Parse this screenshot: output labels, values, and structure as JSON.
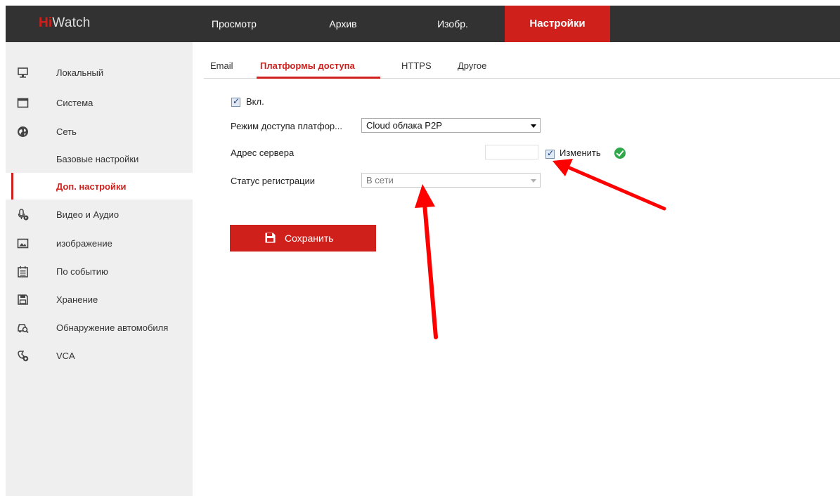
{
  "header": {
    "logo_hi": "Hi",
    "logo_rest": "Watch",
    "nav": [
      {
        "label": "Просмотр"
      },
      {
        "label": "Архив"
      },
      {
        "label": "Изобр."
      },
      {
        "label": "Настройки",
        "active": true
      }
    ]
  },
  "sidebar": {
    "items": [
      {
        "label": "Локальный",
        "icon": "monitor-icon"
      },
      {
        "label": "Система",
        "icon": "window-icon"
      },
      {
        "label": "Сеть",
        "icon": "globe-icon"
      },
      {
        "label": "Базовые настройки"
      },
      {
        "label": "Доп. настройки",
        "active": true
      },
      {
        "label": "Видео и Аудио",
        "icon": "microphone-icon"
      },
      {
        "label": "изображение",
        "icon": "image-icon"
      },
      {
        "label": "По событию",
        "icon": "calendar-icon"
      },
      {
        "label": "Хранение",
        "icon": "floppy-disk-icon"
      },
      {
        "label": "Обнаружение автомобиля",
        "icon": "car-search-icon"
      },
      {
        "label": "VCA",
        "icon": "vca-icon"
      }
    ]
  },
  "tabs": [
    {
      "label": "Email"
    },
    {
      "label": "Платформы доступа",
      "active": true
    },
    {
      "label": "HTTPS"
    },
    {
      "label": "Другое"
    }
  ],
  "form": {
    "enable_label": "Вкл.",
    "enable_checked": true,
    "mode_label": "Режим доступа платфор...",
    "mode_value": "Cloud облака P2P",
    "server_label": "Адрес сервера",
    "server_value": "",
    "change_label": "Изменить",
    "change_checked": true,
    "status_label": "Статус регистрации",
    "status_value": "В сети"
  },
  "save_button": {
    "label": "Сохранить"
  },
  "colors": {
    "accent": "#d0201b",
    "topbar": "#323232",
    "sidebar": "#efefef",
    "ok": "#2fa84a",
    "annotation": "#ff0000"
  }
}
